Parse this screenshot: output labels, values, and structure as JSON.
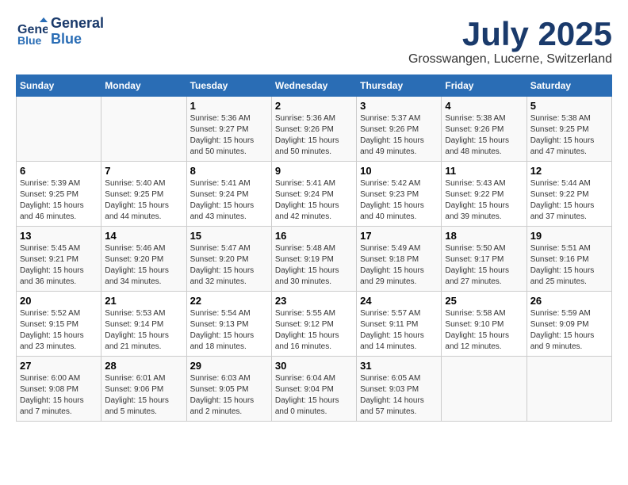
{
  "logo": {
    "line1": "General",
    "line2": "Blue"
  },
  "title": "July 2025",
  "location": "Grosswangen, Lucerne, Switzerland",
  "weekdays": [
    "Sunday",
    "Monday",
    "Tuesday",
    "Wednesday",
    "Thursday",
    "Friday",
    "Saturday"
  ],
  "weeks": [
    [
      {
        "day": "",
        "info": ""
      },
      {
        "day": "",
        "info": ""
      },
      {
        "day": "1",
        "info": "Sunrise: 5:36 AM\nSunset: 9:27 PM\nDaylight: 15 hours\nand 50 minutes."
      },
      {
        "day": "2",
        "info": "Sunrise: 5:36 AM\nSunset: 9:26 PM\nDaylight: 15 hours\nand 50 minutes."
      },
      {
        "day": "3",
        "info": "Sunrise: 5:37 AM\nSunset: 9:26 PM\nDaylight: 15 hours\nand 49 minutes."
      },
      {
        "day": "4",
        "info": "Sunrise: 5:38 AM\nSunset: 9:26 PM\nDaylight: 15 hours\nand 48 minutes."
      },
      {
        "day": "5",
        "info": "Sunrise: 5:38 AM\nSunset: 9:25 PM\nDaylight: 15 hours\nand 47 minutes."
      }
    ],
    [
      {
        "day": "6",
        "info": "Sunrise: 5:39 AM\nSunset: 9:25 PM\nDaylight: 15 hours\nand 46 minutes."
      },
      {
        "day": "7",
        "info": "Sunrise: 5:40 AM\nSunset: 9:25 PM\nDaylight: 15 hours\nand 44 minutes."
      },
      {
        "day": "8",
        "info": "Sunrise: 5:41 AM\nSunset: 9:24 PM\nDaylight: 15 hours\nand 43 minutes."
      },
      {
        "day": "9",
        "info": "Sunrise: 5:41 AM\nSunset: 9:24 PM\nDaylight: 15 hours\nand 42 minutes."
      },
      {
        "day": "10",
        "info": "Sunrise: 5:42 AM\nSunset: 9:23 PM\nDaylight: 15 hours\nand 40 minutes."
      },
      {
        "day": "11",
        "info": "Sunrise: 5:43 AM\nSunset: 9:22 PM\nDaylight: 15 hours\nand 39 minutes."
      },
      {
        "day": "12",
        "info": "Sunrise: 5:44 AM\nSunset: 9:22 PM\nDaylight: 15 hours\nand 37 minutes."
      }
    ],
    [
      {
        "day": "13",
        "info": "Sunrise: 5:45 AM\nSunset: 9:21 PM\nDaylight: 15 hours\nand 36 minutes."
      },
      {
        "day": "14",
        "info": "Sunrise: 5:46 AM\nSunset: 9:20 PM\nDaylight: 15 hours\nand 34 minutes."
      },
      {
        "day": "15",
        "info": "Sunrise: 5:47 AM\nSunset: 9:20 PM\nDaylight: 15 hours\nand 32 minutes."
      },
      {
        "day": "16",
        "info": "Sunrise: 5:48 AM\nSunset: 9:19 PM\nDaylight: 15 hours\nand 30 minutes."
      },
      {
        "day": "17",
        "info": "Sunrise: 5:49 AM\nSunset: 9:18 PM\nDaylight: 15 hours\nand 29 minutes."
      },
      {
        "day": "18",
        "info": "Sunrise: 5:50 AM\nSunset: 9:17 PM\nDaylight: 15 hours\nand 27 minutes."
      },
      {
        "day": "19",
        "info": "Sunrise: 5:51 AM\nSunset: 9:16 PM\nDaylight: 15 hours\nand 25 minutes."
      }
    ],
    [
      {
        "day": "20",
        "info": "Sunrise: 5:52 AM\nSunset: 9:15 PM\nDaylight: 15 hours\nand 23 minutes."
      },
      {
        "day": "21",
        "info": "Sunrise: 5:53 AM\nSunset: 9:14 PM\nDaylight: 15 hours\nand 21 minutes."
      },
      {
        "day": "22",
        "info": "Sunrise: 5:54 AM\nSunset: 9:13 PM\nDaylight: 15 hours\nand 18 minutes."
      },
      {
        "day": "23",
        "info": "Sunrise: 5:55 AM\nSunset: 9:12 PM\nDaylight: 15 hours\nand 16 minutes."
      },
      {
        "day": "24",
        "info": "Sunrise: 5:57 AM\nSunset: 9:11 PM\nDaylight: 15 hours\nand 14 minutes."
      },
      {
        "day": "25",
        "info": "Sunrise: 5:58 AM\nSunset: 9:10 PM\nDaylight: 15 hours\nand 12 minutes."
      },
      {
        "day": "26",
        "info": "Sunrise: 5:59 AM\nSunset: 9:09 PM\nDaylight: 15 hours\nand 9 minutes."
      }
    ],
    [
      {
        "day": "27",
        "info": "Sunrise: 6:00 AM\nSunset: 9:08 PM\nDaylight: 15 hours\nand 7 minutes."
      },
      {
        "day": "28",
        "info": "Sunrise: 6:01 AM\nSunset: 9:06 PM\nDaylight: 15 hours\nand 5 minutes."
      },
      {
        "day": "29",
        "info": "Sunrise: 6:03 AM\nSunset: 9:05 PM\nDaylight: 15 hours\nand 2 minutes."
      },
      {
        "day": "30",
        "info": "Sunrise: 6:04 AM\nSunset: 9:04 PM\nDaylight: 15 hours\nand 0 minutes."
      },
      {
        "day": "31",
        "info": "Sunrise: 6:05 AM\nSunset: 9:03 PM\nDaylight: 14 hours\nand 57 minutes."
      },
      {
        "day": "",
        "info": ""
      },
      {
        "day": "",
        "info": ""
      }
    ]
  ]
}
